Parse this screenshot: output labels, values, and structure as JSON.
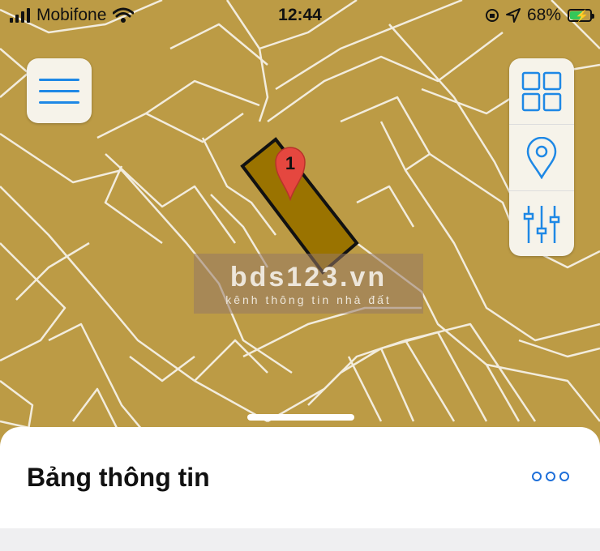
{
  "status_bar": {
    "carrier": "Mobifone",
    "time": "12:44",
    "battery_percent": "68%",
    "battery_level": 0.68
  },
  "map": {
    "background_color": "#BC9B45",
    "highlight_color": "#9A7300",
    "pin_label": "1"
  },
  "watermark": {
    "brand": "bds123.vn",
    "tagline": "kênh thông tin nhà đất"
  },
  "toolbar": {
    "icons": [
      "grid-icon",
      "location-pin-icon",
      "sliders-icon"
    ]
  },
  "sheet": {
    "title": "Bảng thông tin"
  },
  "colors": {
    "accent": "#1E88E5",
    "panel": "#F6F3EA"
  }
}
